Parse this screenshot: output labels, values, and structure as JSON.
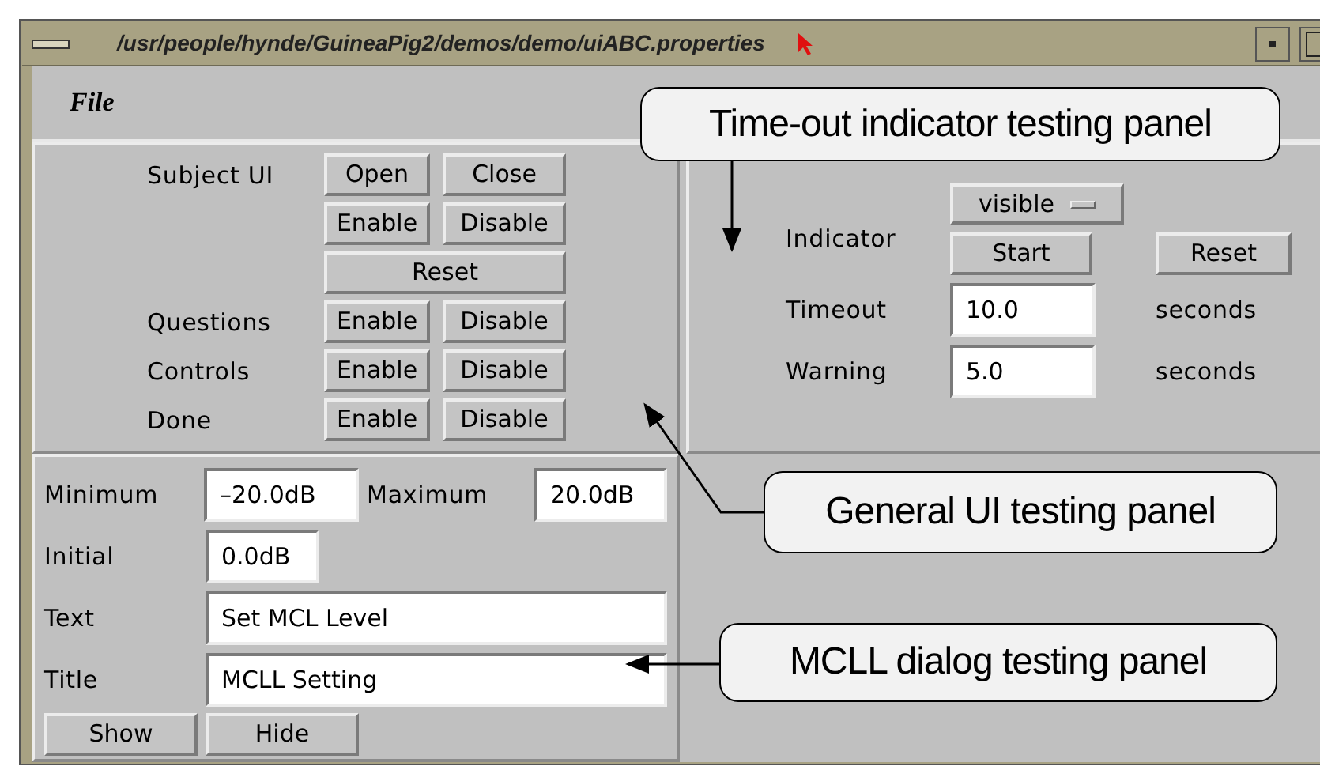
{
  "window": {
    "title": "/usr/people/hynde/GuineaPig2/demos/demo/uiABC.properties"
  },
  "menu": [
    {
      "label": "File"
    }
  ],
  "general_panel": {
    "rows": [
      {
        "label": "Subject UI",
        "buttons": [
          "Open",
          "Close"
        ]
      },
      {
        "buttons": [
          "Enable",
          "Disable"
        ]
      },
      {
        "buttons": [
          "Reset"
        ]
      },
      {
        "label": "Questions",
        "buttons": [
          "Enable",
          "Disable"
        ]
      },
      {
        "label": "Controls",
        "buttons": [
          "Enable",
          "Disable"
        ]
      },
      {
        "label": "Done",
        "buttons": [
          "Enable",
          "Disable"
        ]
      }
    ]
  },
  "timeout_panel": {
    "indicator_label": "Indicator",
    "indicator_value": "visible",
    "buttons": [
      "Start",
      "Reset"
    ],
    "fields": [
      {
        "label": "Timeout",
        "value": "10.0",
        "unit": "seconds"
      },
      {
        "label": "Warning",
        "value": "5.0",
        "unit": "seconds"
      }
    ]
  },
  "mcll_panel": {
    "minimum_label": "Minimum",
    "minimum": "–20.0dB",
    "maximum_label": "Maximum",
    "maximum": "20.0dB",
    "initial_label": "Initial",
    "initial": "0.0dB",
    "text_label": "Text",
    "text": "Set MCL Level",
    "title_label": "Title",
    "title": "MCLL Setting",
    "buttons": [
      "Show",
      "Hide"
    ]
  },
  "callouts": [
    {
      "text": "Time-out indicator testing panel"
    },
    {
      "text": "General UI testing panel"
    },
    {
      "text": "MCLL dialog testing panel"
    }
  ]
}
